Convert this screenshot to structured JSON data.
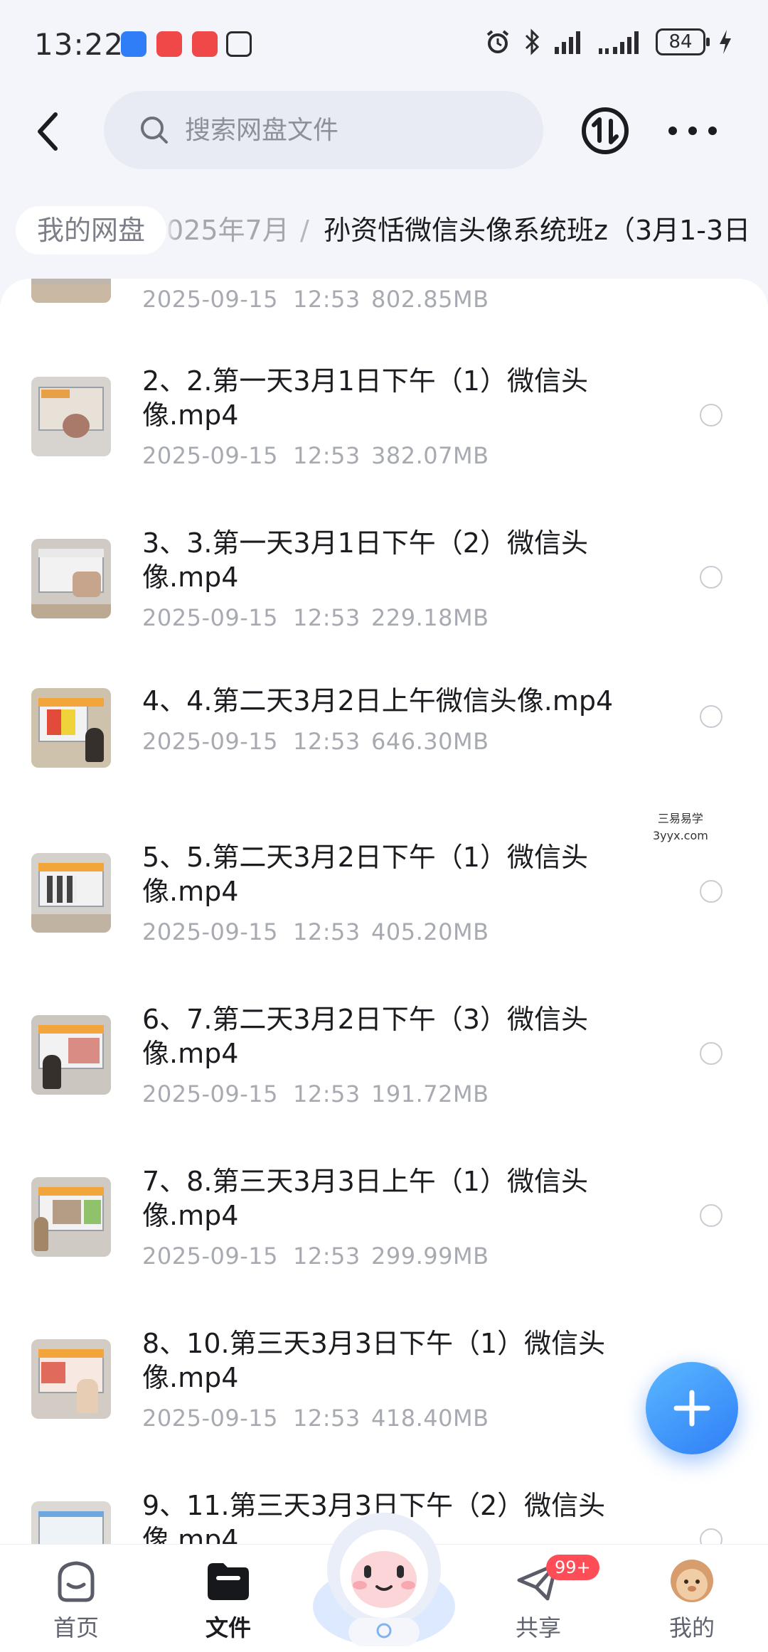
{
  "status_bar": {
    "time": "13:22",
    "battery": "84",
    "icons": [
      "app-icon-blue",
      "app-icon-red",
      "app-icon-red",
      "nfc-icon",
      "alarm-icon",
      "bluetooth-icon",
      "signal-icon",
      "signal-icon",
      "charging-icon"
    ]
  },
  "header": {
    "search_placeholder": "搜索网盘文件",
    "back_icon": "back-arrow-icon",
    "transfer_icon": "transfer-icon",
    "more_icon": "more-dots-icon"
  },
  "breadcrumb": {
    "root": "我的网盘",
    "middle": "025年7月",
    "separator": "/",
    "current": "孙资恬微信头像系统班z（3月1-3日"
  },
  "files": [
    {
      "name": "",
      "date": "2025-09-15",
      "time": "12:53",
      "size": "802.85MB"
    },
    {
      "name": "2、2.第一天3月1日下午（1）微信头像.mp4",
      "date": "2025-09-15",
      "time": "12:53",
      "size": "382.07MB"
    },
    {
      "name": "3、3.第一天3月1日下午（2）微信头像.mp4",
      "date": "2025-09-15",
      "time": "12:53",
      "size": "229.18MB"
    },
    {
      "name": "4、4.第二天3月2日上午微信头像.mp4",
      "date": "2025-09-15",
      "time": "12:53",
      "size": "646.30MB"
    },
    {
      "name": "5、5.第二天3月2日下午（1）微信头像.mp4",
      "date": "2025-09-15",
      "time": "12:53",
      "size": "405.20MB"
    },
    {
      "name": "6、7.第二天3月2日下午（3）微信头像.mp4",
      "date": "2025-09-15",
      "time": "12:53",
      "size": "191.72MB"
    },
    {
      "name": "7、8.第三天3月3日上午（1）微信头像.mp4",
      "date": "2025-09-15",
      "time": "12:53",
      "size": "299.99MB"
    },
    {
      "name": "8、10.第三天3月3日下午（1）微信头像.mp4",
      "date": "2025-09-15",
      "time": "12:53",
      "size": "418.40MB"
    },
    {
      "name": "9、11.第三天3月3日下午（2）微信头像.mp4",
      "date": "",
      "time": "",
      "size": ""
    }
  ],
  "watermark": {
    "line1": "三易易学",
    "line2": "3yyx.com"
  },
  "fab_icon": "plus-icon",
  "nav": {
    "home": "首页",
    "files": "文件",
    "share": "共享",
    "share_badge": "99+",
    "mine": "我的"
  },
  "colors": {
    "accent": "#2f7ef7",
    "badge": "#ff4d57",
    "background": "#f3f5fa"
  }
}
